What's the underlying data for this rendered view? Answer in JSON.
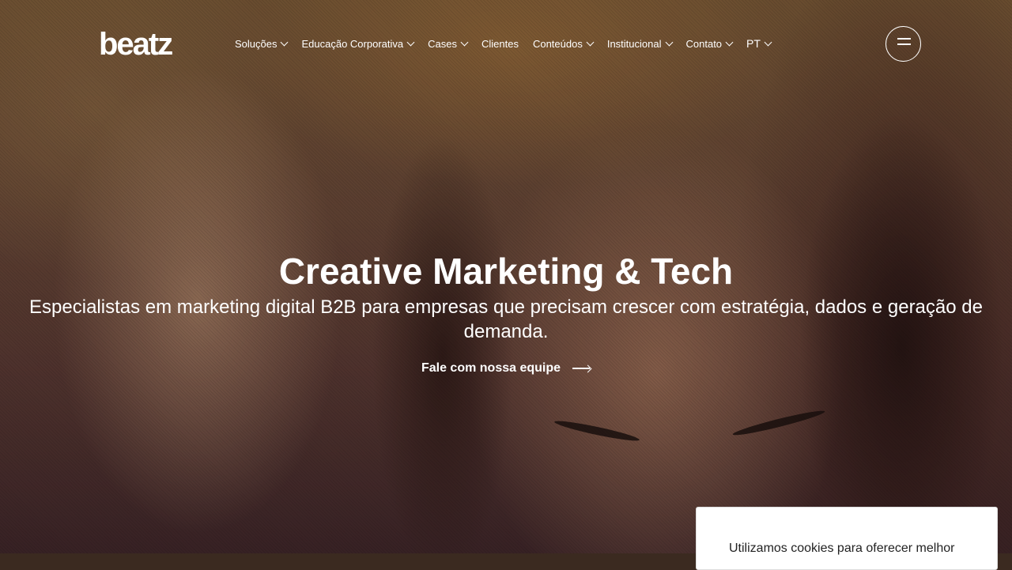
{
  "brand": {
    "logo_text": "beatz"
  },
  "nav": {
    "items": [
      {
        "label": "Soluções",
        "dropdown": true
      },
      {
        "label": "Educação Corporativa",
        "dropdown": true
      },
      {
        "label": "Cases",
        "dropdown": true
      },
      {
        "label": "Clientes",
        "dropdown": false
      },
      {
        "label": "Conteúdos",
        "dropdown": true
      },
      {
        "label": "Institucional",
        "dropdown": true
      },
      {
        "label": "Contato",
        "dropdown": true
      }
    ],
    "language": "PT"
  },
  "hero": {
    "title": "Creative Marketing & Tech",
    "subtitle": "Especialistas em marketing digital B2B para empresas que precisam crescer com estratégia, dados e geração de demanda.",
    "cta_label": "Fale com nossa equipe"
  },
  "cookie": {
    "text": "Utilizamos cookies para oferecer melhor"
  },
  "icons": {
    "menu": "hamburger-icon",
    "chevron": "chevron-down-icon",
    "arrow": "arrow-right-icon"
  },
  "colors": {
    "text": "#ffffff",
    "cookie_bg": "#ffffff",
    "cookie_text": "#222222"
  }
}
